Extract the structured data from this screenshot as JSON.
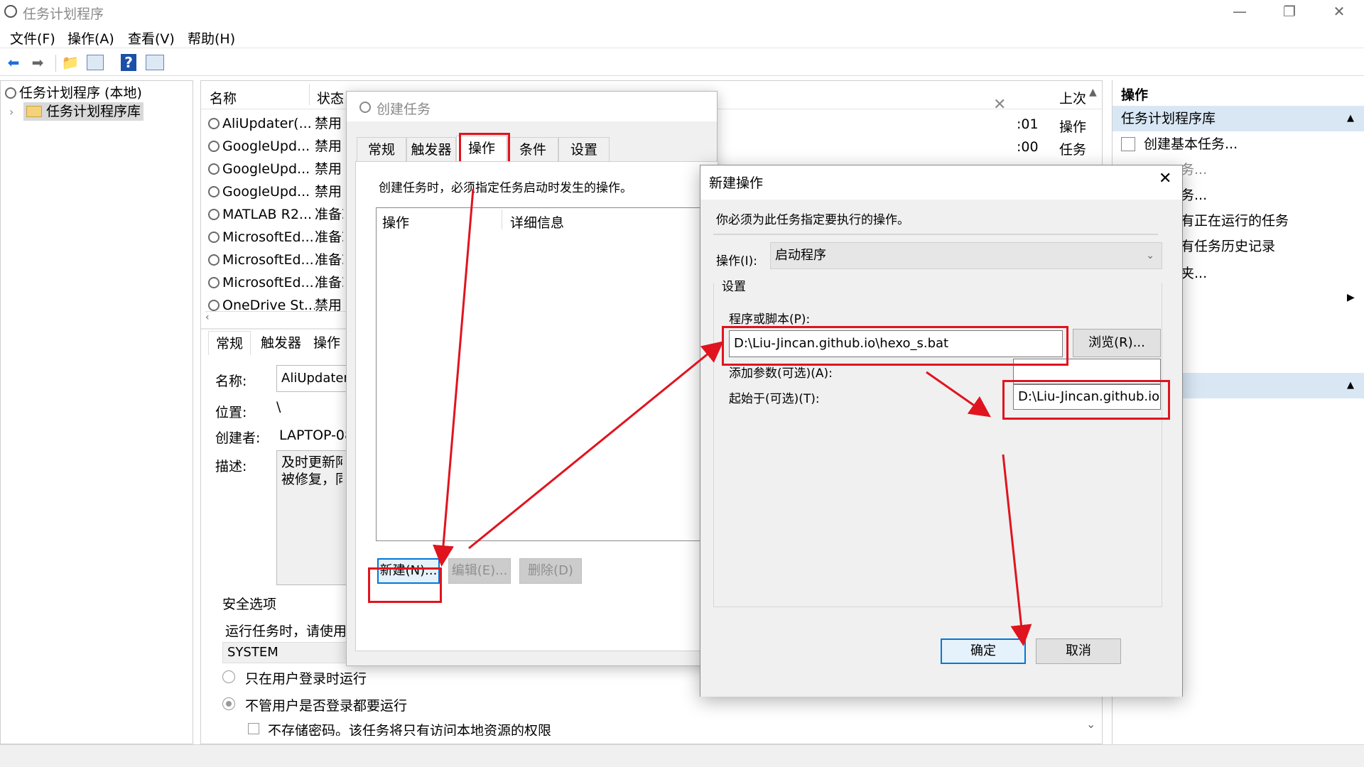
{
  "window": {
    "title": "任务计划程序",
    "min_glyph": "—",
    "restore_glyph": "❐",
    "close_glyph": "✕"
  },
  "menu": [
    "文件(F)",
    "操作(A)",
    "查看(V)",
    "帮助(H)"
  ],
  "toolbar_icons": [
    "back-arrow-icon",
    "forward-arrow-icon",
    "folder-up-icon",
    "show-hide-pane-icon",
    "help-icon",
    "properties-pane-icon"
  ],
  "tree": {
    "root": "任务计划程序 (本地)",
    "child": "任务计划程序库"
  },
  "task_list": {
    "columns": [
      "名称",
      "状态",
      "上次"
    ],
    "rows": [
      {
        "name": "AliUpdater(...",
        "status": "禁用"
      },
      {
        "name": "GoogleUpd...",
        "status": "禁用"
      },
      {
        "name": "GoogleUpd...",
        "status": "禁用"
      },
      {
        "name": "GoogleUpd...",
        "status": "禁用"
      },
      {
        "name": "MATLAB R2...",
        "status": "准备就"
      },
      {
        "name": "MicrosoftEd...",
        "status": "准备就"
      },
      {
        "name": "MicrosoftEd...",
        "status": "准备就"
      },
      {
        "name": "MicrosoftEd...",
        "status": "准备就"
      },
      {
        "name": "OneDrive St...",
        "status": "禁用"
      }
    ],
    "right_cells": [
      {
        "time": ":01",
        "col": "操作"
      },
      {
        "time": ":00",
        "col": "任务"
      }
    ]
  },
  "details": {
    "tabs": [
      "常规",
      "触发器",
      "操作"
    ],
    "name_label": "名称:",
    "name_value": "AliUpdater(",
    "location_label": "位置:",
    "location_value": "\\",
    "author_label": "创建者:",
    "author_value": "LAPTOP-08",
    "desc_label": "描述:",
    "desc_line1": "及时更新阿",
    "desc_line2": "被修复，同",
    "security_title": "安全选项",
    "security_line": "运行任务时，请使用",
    "security_account": "SYSTEM",
    "radio1": "只在用户登录时运行",
    "radio2": "不管用户是否登录都要运行",
    "checkbox": "不存储密码。该任务将只有访问本地资源的权限"
  },
  "actions_pane": {
    "header": "操作",
    "section1": "任务计划程序库",
    "items": [
      "创建基本任务...",
      "务...",
      "务...",
      "有正在运行的任务",
      "有任务历史记录",
      "夹..."
    ]
  },
  "create_task": {
    "title": "创建任务",
    "tabs": [
      "常规",
      "触发器",
      "操作",
      "条件",
      "设置"
    ],
    "active_tab_index": 2,
    "description": "创建任务时，必须指定任务启动时发生的操作。",
    "list_columns": [
      "操作",
      "详细信息"
    ],
    "buttons": {
      "new": "新建(N)...",
      "edit": "编辑(E)...",
      "delete": "删除(D)"
    }
  },
  "new_action": {
    "title": "新建操作",
    "description": "你必须为此任务指定要执行的操作。",
    "action_label": "操作(I):",
    "action_value": "启动程序",
    "settings_label": "设置",
    "program_label": "程序或脚本(P):",
    "program_value": "D:\\Liu-Jincan.github.io\\hexo_s.bat",
    "browse_button": "浏览(R)...",
    "args_label": "添加参数(可选)(A):",
    "args_value": "",
    "start_label": "起始于(可选)(T):",
    "start_value": "D:\\Liu-Jincan.github.io",
    "ok_button": "确定",
    "cancel_button": "取消"
  },
  "annotation_color": "#e0141e"
}
